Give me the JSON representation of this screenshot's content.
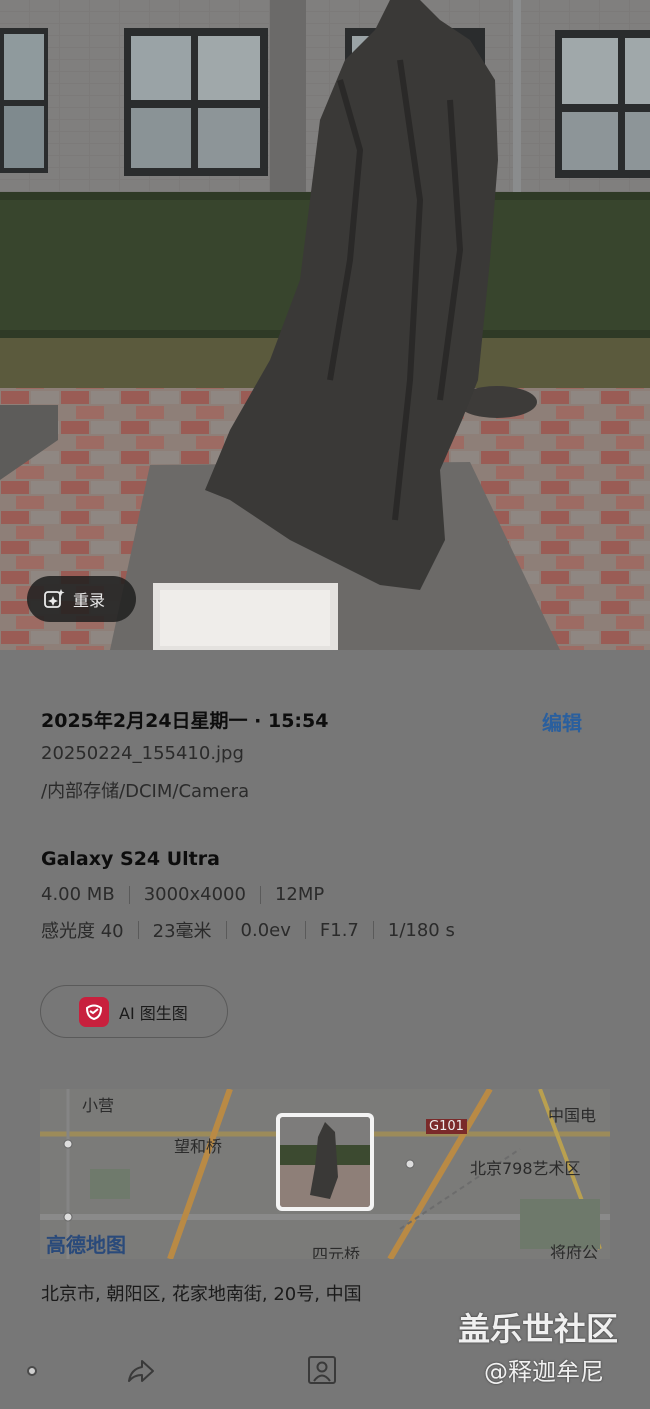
{
  "photo": {
    "remaster_label": "重录",
    "remaster_icon": "sparkle-edit-icon"
  },
  "details": {
    "datetime": "2025年2月24日星期一 · 15:54",
    "edit_label": "编辑",
    "filename": "20250224_155410.jpg",
    "path": "/内部存储/DCIM/Camera",
    "device": "Galaxy S24 Ultra",
    "file_specs": [
      "4.00 MB",
      "3000x4000",
      "12MP"
    ],
    "camera_specs": [
      "感光度 40",
      "23毫米",
      "0.0ev",
      "F1.7",
      "1/180 s"
    ],
    "ai_button_label": "AI 图生图",
    "map": {
      "labels": [
        "小营",
        "望和桥",
        "G101",
        "北京798艺术区",
        "中国电",
        "高德地图",
        "四元桥",
        "将府公"
      ]
    },
    "address": "北京市, 朝阳区, 花家地南街, 20号, 中国"
  },
  "watermark": {
    "line1": "盖乐世社区",
    "line2": "@释迦牟尼"
  },
  "bottom_bar": {
    "icons": [
      "dot-indicator-icon",
      "share-icon",
      "person-tag-icon"
    ]
  },
  "colors": {
    "accent": "#2a5f9e",
    "panel_bg": "#777777",
    "ai_logo": "#c8203d"
  }
}
